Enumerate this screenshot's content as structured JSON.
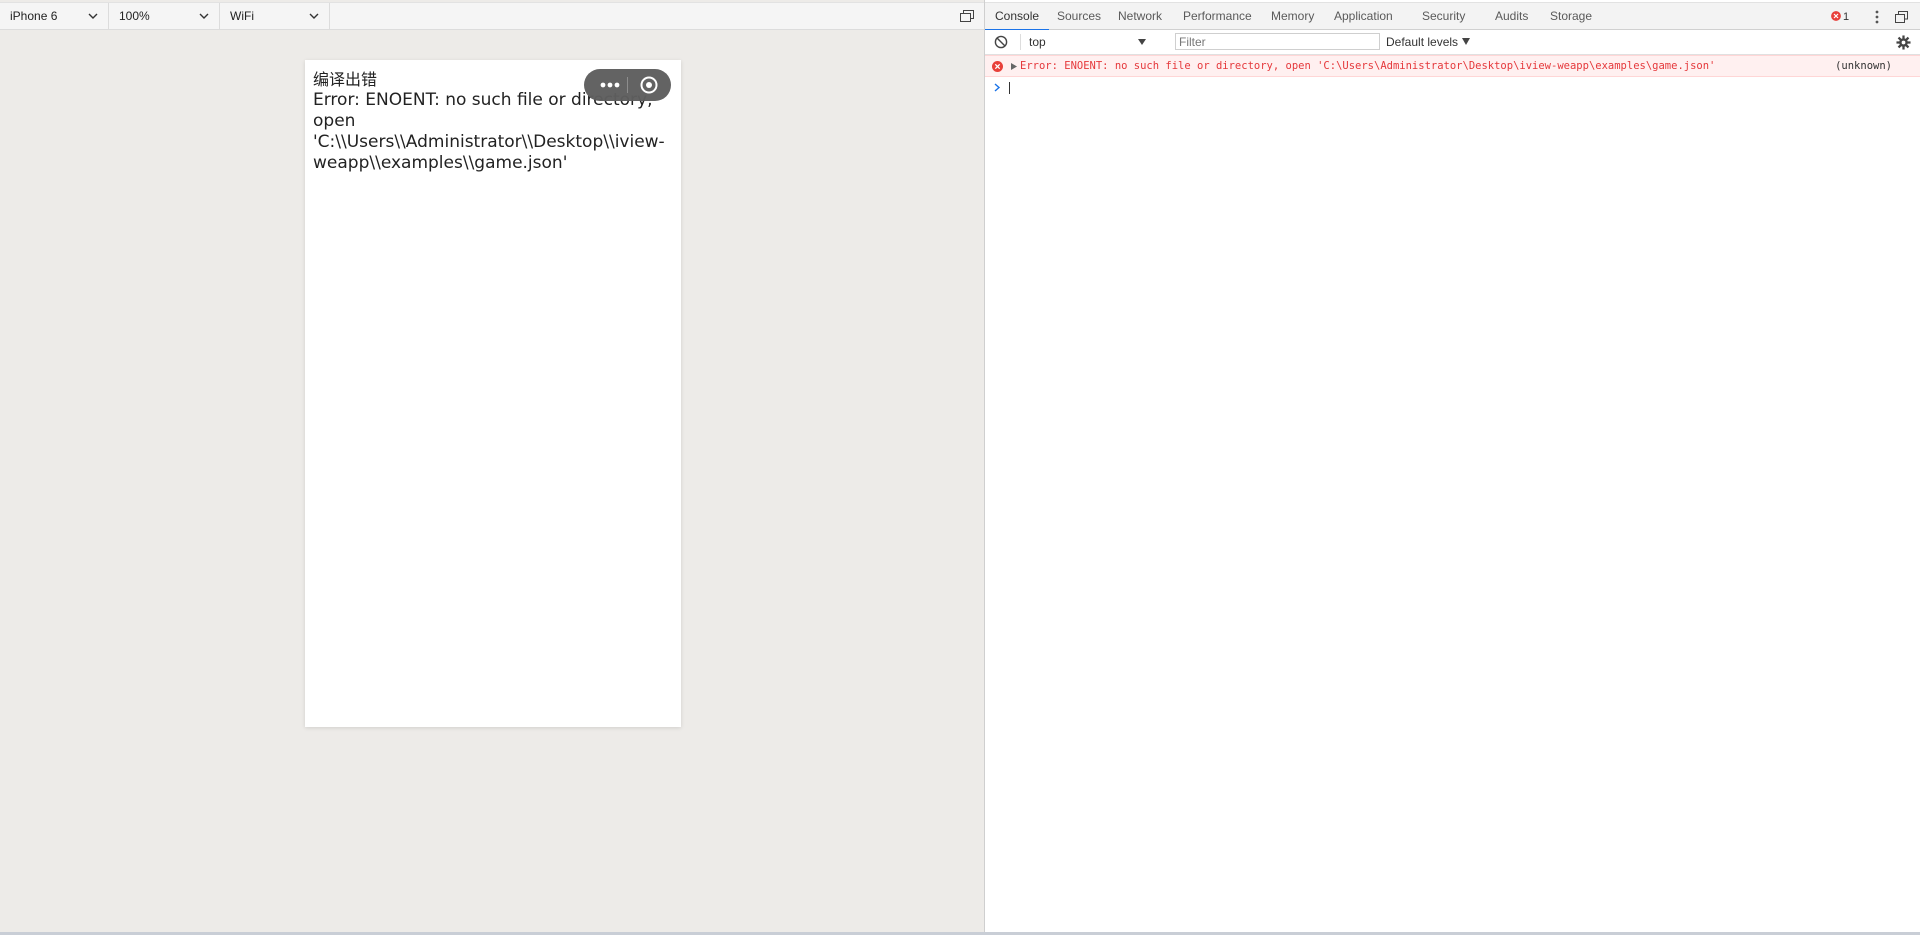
{
  "simulator": {
    "device": "iPhone 6",
    "zoom": "100%",
    "network": "WiFi",
    "page": {
      "title": "编译出错",
      "message": "Error: ENOENT: no such file or directory, open 'C:\\\\Users\\\\Administrator\\\\Desktop\\\\iview-weapp\\\\examples\\\\game.json'"
    }
  },
  "devtools": {
    "tabs": [
      {
        "label": "Console",
        "active": true
      },
      {
        "label": "Sources"
      },
      {
        "label": "Network"
      },
      {
        "label": "Performance"
      },
      {
        "label": "Memory"
      },
      {
        "label": "Application"
      },
      {
        "label": "Security"
      },
      {
        "label": "Audits"
      },
      {
        "label": "Storage"
      }
    ],
    "error_count": "1",
    "console": {
      "context": "top",
      "filter_placeholder": "Filter",
      "levels": "Default levels",
      "messages": [
        {
          "level": "error",
          "text": "Error: ENOENT: no such file or directory, open 'C:\\Users\\Administrator\\Desktop\\iview-weapp\\examples\\game.json'",
          "source": "(unknown)"
        }
      ]
    }
  },
  "colors": {
    "accent": "#1a73e8",
    "error": "#e5383b",
    "error_bg": "#fff0f0",
    "simulator_bg": "#edebe8"
  }
}
